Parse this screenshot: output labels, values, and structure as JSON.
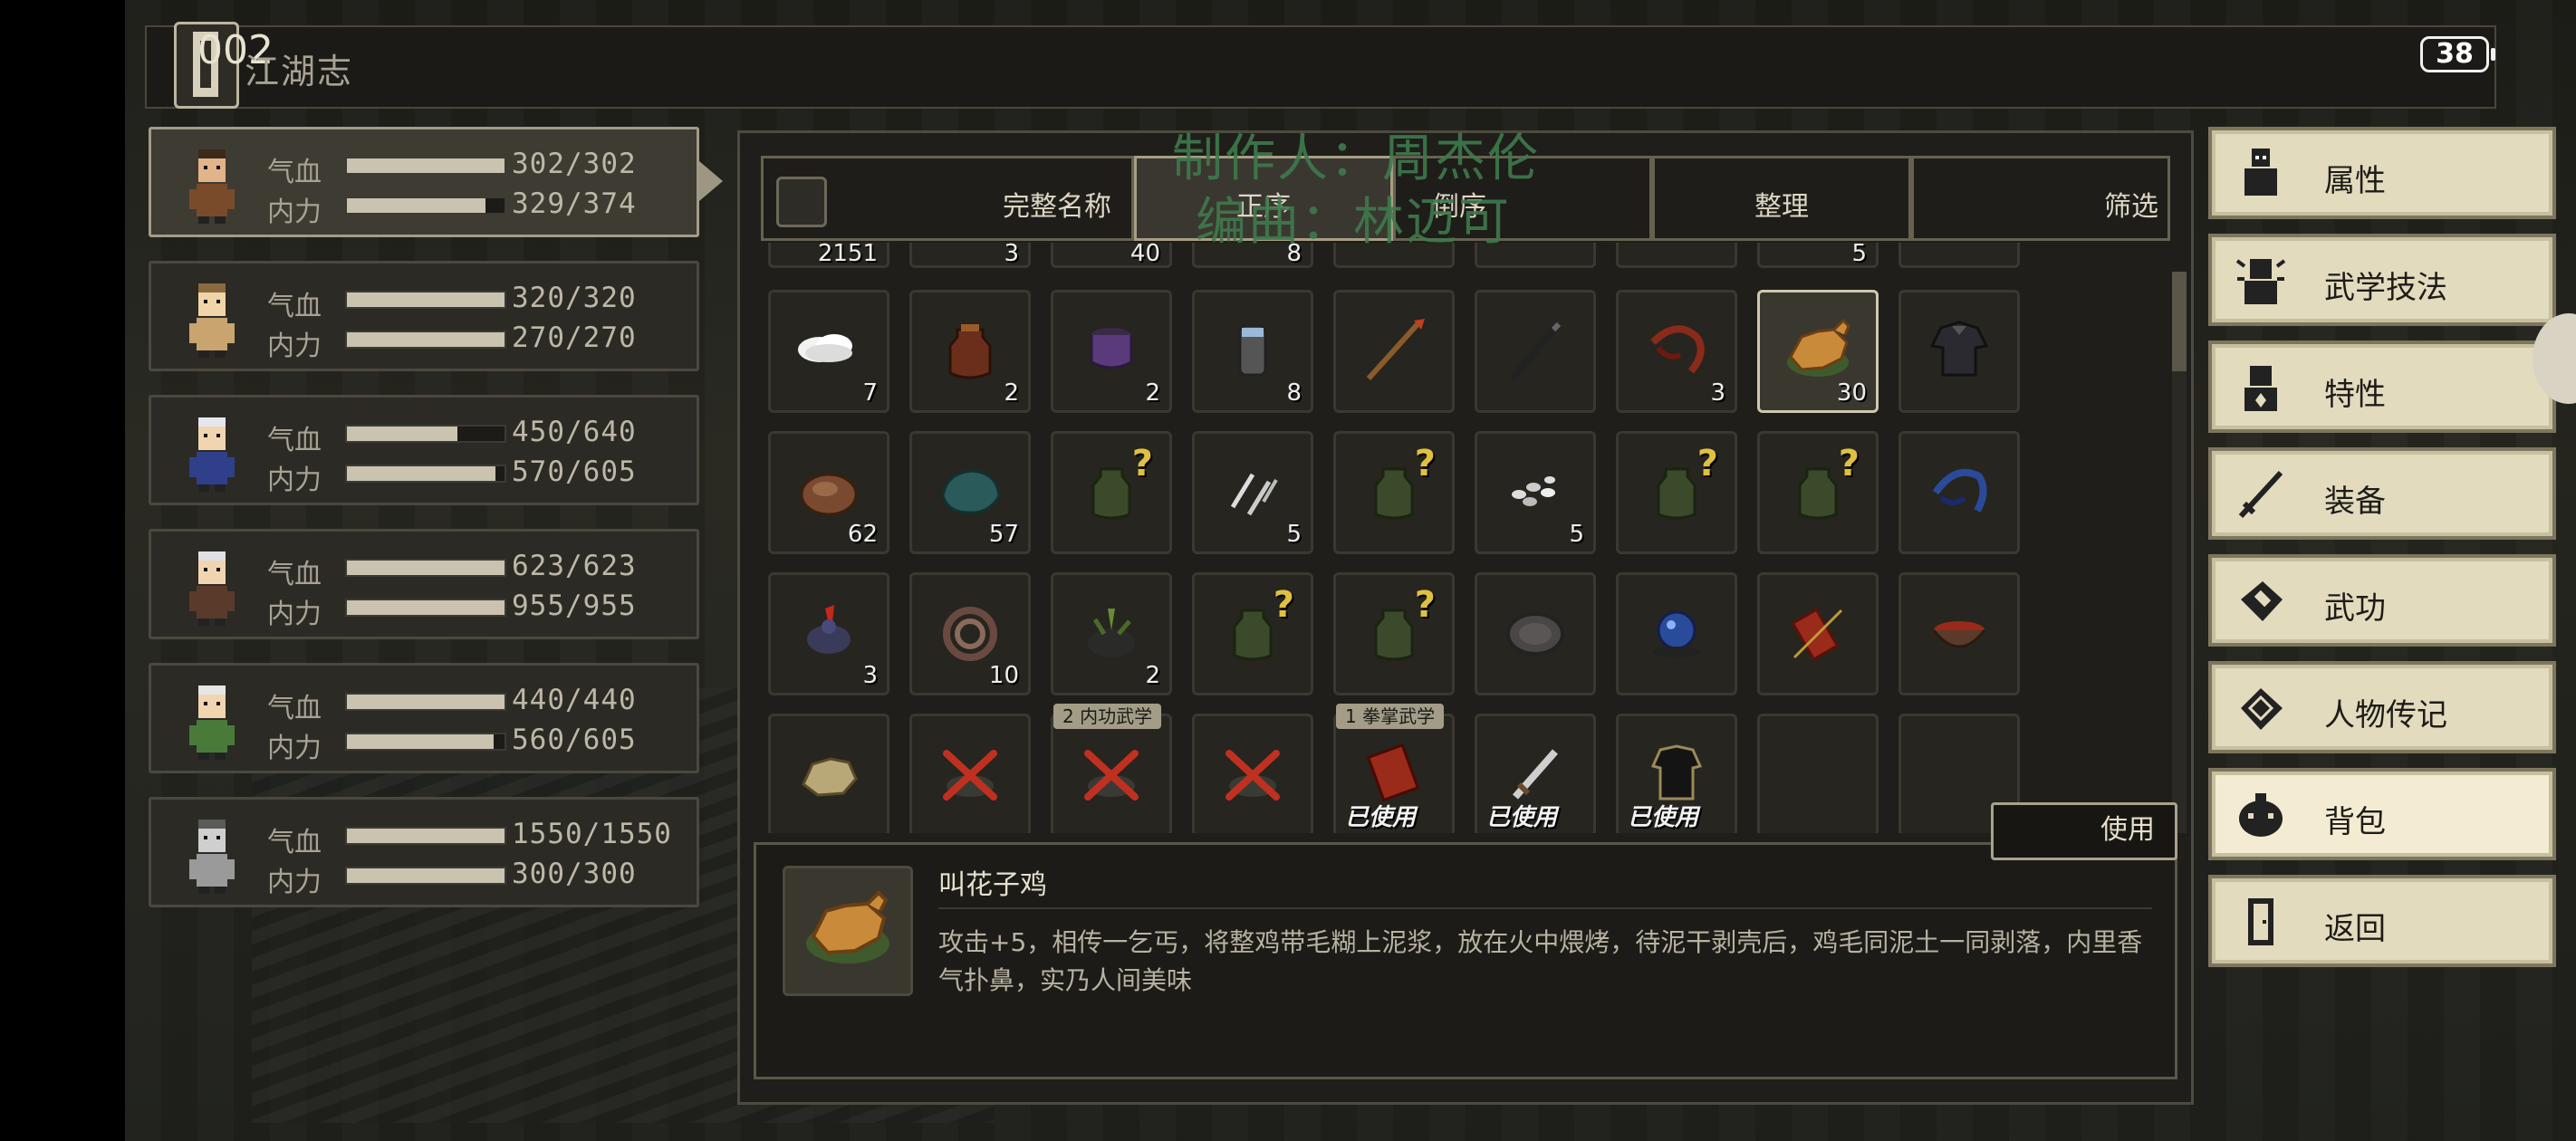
{
  "top": {
    "number": "002",
    "title": "江湖志",
    "battery": "38"
  },
  "credits": {
    "line1": "制作人：周杰伦",
    "line2": "编曲：林迈可"
  },
  "party": [
    {
      "name_hp": "气血",
      "name_mp": "内力",
      "hp": "302/302",
      "mp": "329/374",
      "hp_ratio": 1.0,
      "mp_ratio": 0.88,
      "active": true
    },
    {
      "name_hp": "气血",
      "name_mp": "内力",
      "hp": "320/320",
      "mp": "270/270",
      "hp_ratio": 1.0,
      "mp_ratio": 1.0
    },
    {
      "name_hp": "气血",
      "name_mp": "内力",
      "hp": "450/640",
      "mp": "570/605",
      "hp_ratio": 0.7,
      "mp_ratio": 0.94
    },
    {
      "name_hp": "气血",
      "name_mp": "内力",
      "hp": "623/623",
      "mp": "955/955",
      "hp_ratio": 1.0,
      "mp_ratio": 1.0
    },
    {
      "name_hp": "气血",
      "name_mp": "内力",
      "hp": "440/440",
      "mp": "560/605",
      "hp_ratio": 1.0,
      "mp_ratio": 0.93
    },
    {
      "name_hp": "气血",
      "name_mp": "内力",
      "hp": "1550/1550",
      "mp": "300/300",
      "hp_ratio": 1.0,
      "mp_ratio": 1.0
    }
  ],
  "toolbar": {
    "full_name": "完整名称",
    "sort": "正序",
    "reverse": "倒序",
    "organize": "整理",
    "filter": "筛选"
  },
  "inventory": {
    "top_row_partial": [
      "2151",
      "3",
      "40",
      "8",
      "",
      "",
      "",
      "5",
      ""
    ],
    "rows": [
      [
        {
          "icon": "rice-ball-icon",
          "qty": "7"
        },
        {
          "icon": "wine-jar-icon",
          "qty": "2"
        },
        {
          "icon": "purple-bowl-icon",
          "qty": "2"
        },
        {
          "icon": "lantern-icon",
          "qty": "8"
        },
        {
          "icon": "spear-icon",
          "qty": ""
        },
        {
          "icon": "staff-icon",
          "qty": ""
        },
        {
          "icon": "red-whip-icon",
          "qty": "3"
        },
        {
          "icon": "roast-chicken-icon",
          "qty": "30",
          "selected": true
        },
        {
          "icon": "dark-robe-icon",
          "qty": ""
        }
      ],
      [
        {
          "icon": "bread-icon",
          "qty": "62"
        },
        {
          "icon": "green-stone-icon",
          "qty": "57"
        },
        {
          "icon": "unknown-jar-icon",
          "qty": "",
          "unknown": true
        },
        {
          "icon": "throwing-darts-icon",
          "qty": "5"
        },
        {
          "icon": "unknown-jar-icon",
          "qty": "",
          "unknown": true
        },
        {
          "icon": "pebbles-icon",
          "qty": "5"
        },
        {
          "icon": "unknown-jar-icon",
          "qty": "",
          "unknown": true
        },
        {
          "icon": "unknown-jar-icon",
          "qty": "",
          "unknown": true
        },
        {
          "icon": "blue-whip-icon",
          "qty": ""
        }
      ],
      [
        {
          "icon": "rooster-icon",
          "qty": "3"
        },
        {
          "icon": "rope-coil-icon",
          "qty": "10"
        },
        {
          "icon": "herb-pot-icon",
          "qty": "2"
        },
        {
          "icon": "unknown-jar-icon",
          "qty": "",
          "unknown": true
        },
        {
          "icon": "unknown-jar-icon",
          "qty": "",
          "unknown": true
        },
        {
          "icon": "iron-disc-icon",
          "qty": ""
        },
        {
          "icon": "blue-orb-icon",
          "qty": ""
        },
        {
          "icon": "red-scroll-icon",
          "qty": ""
        },
        {
          "icon": "soup-bowl-icon",
          "qty": ""
        }
      ],
      [
        {
          "icon": "tan-creature-icon",
          "qty": ""
        },
        {
          "icon": "crossed-item-icon",
          "qty": ""
        },
        {
          "icon": "crossed-item-icon",
          "qty": "",
          "tag": "2 内功武学"
        },
        {
          "icon": "crossed-item-icon",
          "qty": ""
        },
        {
          "icon": "red-book-icon",
          "qty": "",
          "tag": "1 拳掌武学",
          "used": "已使用"
        },
        {
          "icon": "sword-icon",
          "qty": "",
          "used": "已使用"
        },
        {
          "icon": "black-armor-icon",
          "qty": "",
          "used": "已使用"
        },
        {
          "icon": "empty-slot",
          "qty": ""
        },
        {
          "icon": "empty-slot",
          "qty": ""
        }
      ]
    ]
  },
  "use_button": "使用",
  "detail": {
    "name": "叫花子鸡",
    "description": "攻击+5，相传一乞丐，将整鸡带毛糊上泥浆，放在火中煨烤，待泥干剥壳后，鸡毛同泥土一同剥落，内里香气扑鼻，实乃人间美味"
  },
  "menu": [
    {
      "label": "属性",
      "icon": "person-icon"
    },
    {
      "label": "武学技法",
      "icon": "martial-skill-icon"
    },
    {
      "label": "特性",
      "icon": "trait-icon"
    },
    {
      "label": "装备",
      "icon": "equipment-icon"
    },
    {
      "label": "武功",
      "icon": "kungfu-icon"
    },
    {
      "label": "人物传记",
      "icon": "biography-icon"
    },
    {
      "label": "背包",
      "icon": "backpack-icon",
      "active": true
    },
    {
      "label": "返回",
      "icon": "door-icon"
    }
  ],
  "colors": {
    "panel": "#1f1e1a",
    "menu_bg": "#e3dbbe",
    "bar_fill": "#c9c3af",
    "selected_border": "#cfc8b0"
  }
}
